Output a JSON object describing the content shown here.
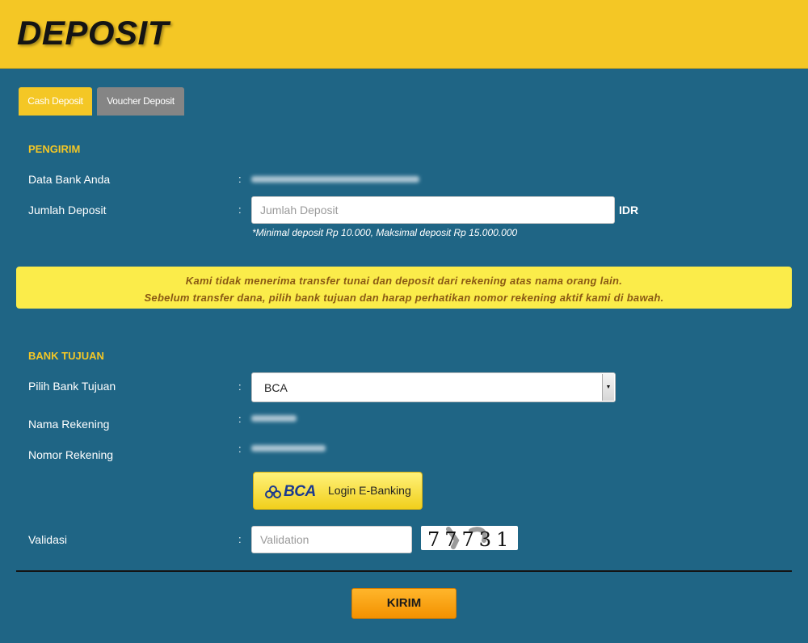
{
  "header": {
    "title": "DEPOSIT"
  },
  "tabs": [
    {
      "label": "Cash Deposit",
      "active": true
    },
    {
      "label": "Voucher Deposit",
      "active": false
    }
  ],
  "pengirim": {
    "title": "PENGIRIM",
    "data_bank_label": "Data Bank Anda",
    "jumlah_label": "Jumlah Deposit",
    "jumlah_placeholder": "Jumlah Deposit",
    "currency": "IDR",
    "note": "*Minimal deposit Rp 10.000, Maksimal deposit Rp 15.000.000",
    "colon": ":"
  },
  "notice": {
    "line1": "Kami tidak menerima transfer tunai dan deposit dari rekening atas nama orang lain.",
    "line2": "Sebelum transfer dana, pilih bank tujuan dan harap perhatikan nomor rekening aktif kami di bawah."
  },
  "bank_tujuan": {
    "title": "BANK TUJUAN",
    "pilih_label": "Pilih Bank Tujuan",
    "selected_bank": "BCA",
    "nama_label": "Nama Rekening",
    "nomor_label": "Nomor Rekening",
    "ebanking_logo_text": "BCA",
    "ebanking_label": "Login E-Banking"
  },
  "validasi": {
    "label": "Validasi",
    "placeholder": "Validation",
    "captcha_code": "77731"
  },
  "submit_label": "KIRIM",
  "colors": {
    "background": "#1f6585",
    "header": "#f4c725",
    "notice": "#fbec4a",
    "submit": "#f39100",
    "inactive_tab": "#858585"
  }
}
